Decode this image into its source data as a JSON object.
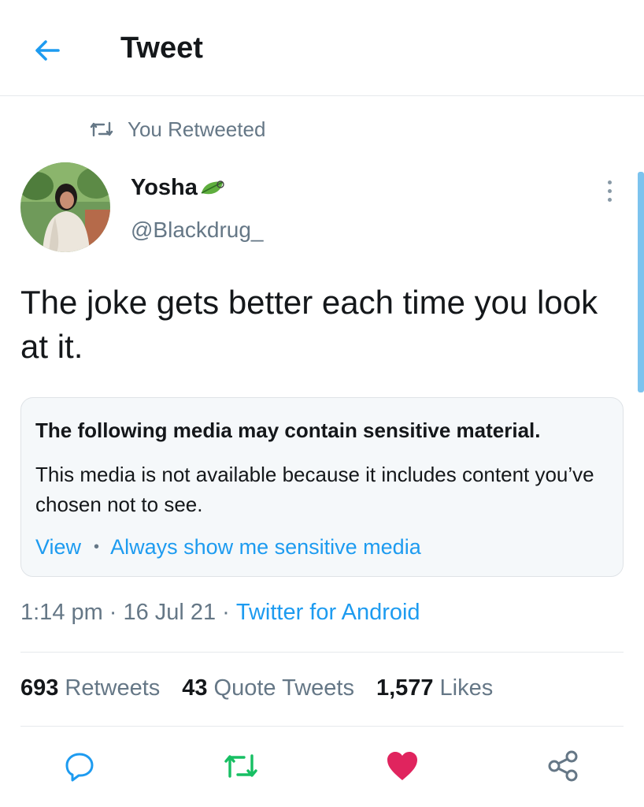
{
  "header": {
    "title": "Tweet",
    "back_icon": "arrow-left-icon"
  },
  "social_context": {
    "text": "You Retweeted",
    "icon": "retweet-icon"
  },
  "author": {
    "display_name": "Yosha",
    "name_emoji": "leaf-icon",
    "handle": "@Blackdrug_"
  },
  "tweet": {
    "text": "The joke gets better each time you look at it."
  },
  "sensitive_notice": {
    "title": "The following media may contain sensitive material.",
    "body": "This media is not available because it includes content you’ve chosen not to see.",
    "view_label": "View",
    "always_show_label": "Always show me sensitive media"
  },
  "meta": {
    "time": "1:14 pm",
    "date": "16 Jul 21",
    "source": "Twitter for Android"
  },
  "stats": {
    "retweets_count": "693",
    "retweets_label": "Retweets",
    "quotes_count": "43",
    "quotes_label": "Quote Tweets",
    "likes_count": "1,577",
    "likes_label": "Likes"
  },
  "colors": {
    "accent": "#1d9bf0",
    "retweet_green": "#17bf63",
    "like_red": "#e0245e",
    "muted": "#657786"
  }
}
